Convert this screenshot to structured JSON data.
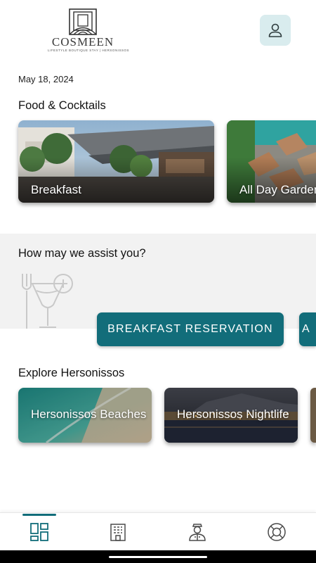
{
  "brand": {
    "name": "COSMEEN",
    "tagline": "LIFESTYLE BOUTIQUE STAY | HERSONISSOS"
  },
  "header": {
    "profile_icon": "user-icon"
  },
  "date": "May 18, 2024",
  "food": {
    "title": "Food & Cocktails",
    "cards": [
      {
        "label": "Breakfast"
      },
      {
        "label": "All Day Garden"
      }
    ]
  },
  "assist": {
    "title": "How may we assist you?",
    "icon": "cocktail-cutlery-icon",
    "buttons": [
      {
        "label": "BREAKFAST RESERVATION"
      },
      {
        "label": "A"
      }
    ]
  },
  "explore": {
    "title": "Explore Hersonissos",
    "cards": [
      {
        "label": "Hersonissos Beaches"
      },
      {
        "label": "Hersonissos Nightlife"
      }
    ]
  },
  "tabs": [
    {
      "icon": "dashboard-icon",
      "active": true
    },
    {
      "icon": "hotel-building-icon",
      "active": false
    },
    {
      "icon": "concierge-icon",
      "active": false
    },
    {
      "icon": "lifebuoy-icon",
      "active": false
    }
  ],
  "colors": {
    "accent": "#126d7a",
    "profile_bg": "#d9ecee",
    "band_bg": "#f2f2f2"
  }
}
